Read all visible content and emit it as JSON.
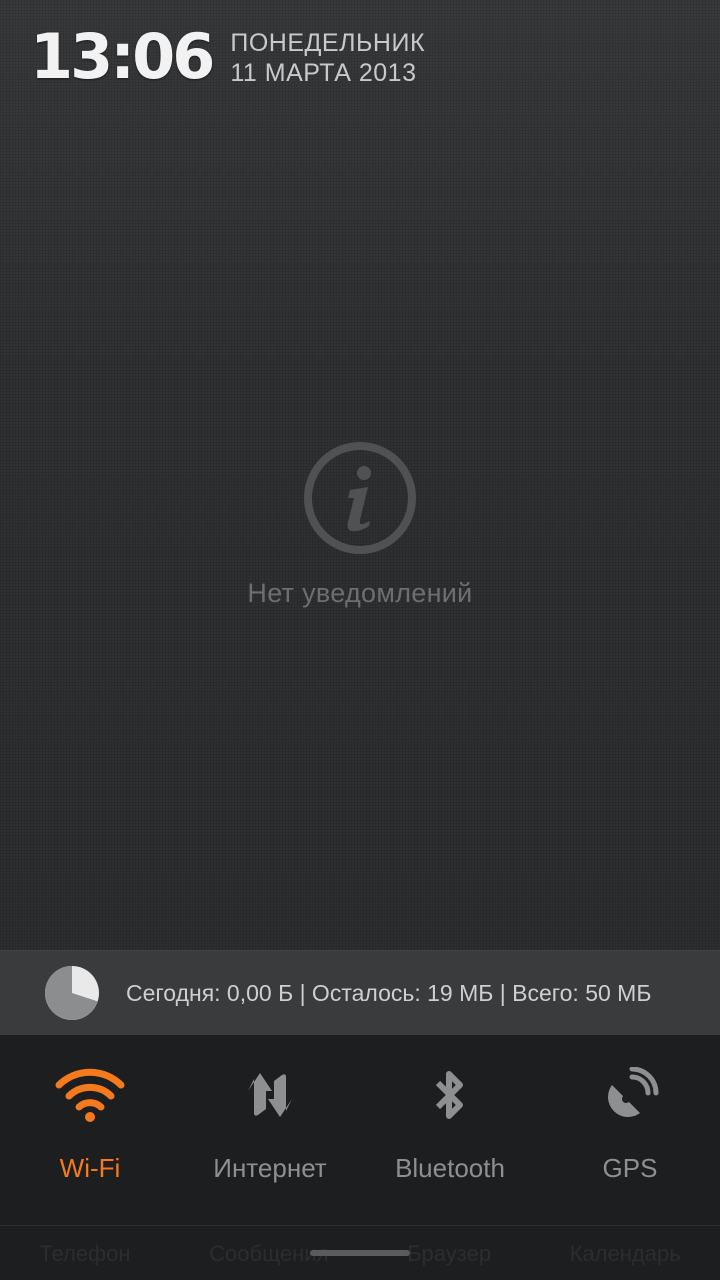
{
  "header": {
    "time": "13:06",
    "weekday": "ПОНЕДЕЛЬНИК",
    "date": "11 МАРТА 2013"
  },
  "notifications": {
    "empty_icon": "info-icon",
    "empty_text": "Нет уведомлений"
  },
  "data_usage": {
    "icon": "pie-chart-icon",
    "used_fraction": 0.7,
    "text": "Сегодня: 0,00 Б | Осталось: 19 МБ | Всего: 50 МБ"
  },
  "toggles": [
    {
      "label": "Wi-Fi",
      "icon": "wifi-icon",
      "active": true
    },
    {
      "label": "Интернет",
      "icon": "mobile-data-icon",
      "active": false
    },
    {
      "label": "Bluetooth",
      "icon": "bluetooth-icon",
      "active": false
    },
    {
      "label": "GPS",
      "icon": "gps-icon",
      "active": false
    }
  ],
  "dock_behind": [
    "Телефон",
    "Сообщения",
    "Браузер",
    "Календарь"
  ],
  "colors": {
    "accent": "#f47a1d",
    "inactive": "#8e8f91",
    "background": "#303133"
  }
}
